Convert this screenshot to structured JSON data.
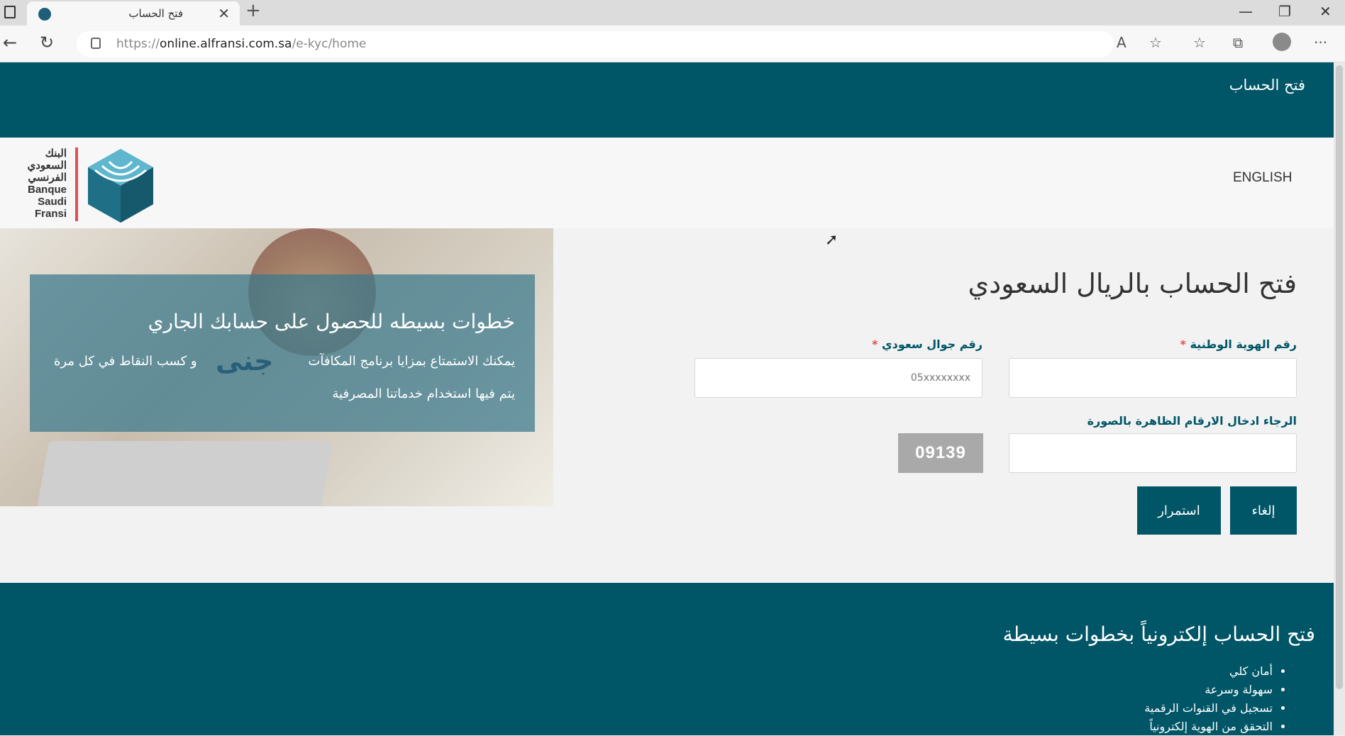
{
  "browser": {
    "tab_title": "فتح الحساب",
    "url_prefix": "https://",
    "url_host": "online.alfransi.com.sa",
    "url_path": "/e-kyc/home"
  },
  "top_band": {
    "title": "فتح الحساب"
  },
  "header": {
    "logo_lines": [
      "البنك",
      "السعودي",
      "الفرنسي",
      "Banque",
      "Saudi",
      "Fransi"
    ],
    "language_link": "ENGLISH"
  },
  "hero": {
    "title": "خطوات بسيطه للحصول على حسابك الجاري",
    "desc_line1": "يمكنك الاستمتاع بمزايا برنامج المكافآت",
    "desc_line1b": "و كسب النقاط في كل مرة",
    "desc_line2": "يتم فيها استخدام خدماتنا المصرفية",
    "rewards_brand": "جنى"
  },
  "form": {
    "title": "فتح الحساب بالريال السعودي",
    "national_id_label": "رقم الهوية الوطنية",
    "national_id_value": "",
    "mobile_label": "رقم جوال سعودي",
    "mobile_placeholder": "05xxxxxxxx",
    "captcha_label": "الرجاء ادخال الارقام الظاهرة بالصورة",
    "captcha_value": "",
    "captcha_code": "09139",
    "required_mark": "*",
    "cancel_label": "إلغاء",
    "continue_label": "استمرار"
  },
  "footer": {
    "title": "فتح الحساب إلكترونياً بخطوات بسيطة",
    "items": [
      "أمان كلي",
      "سهولة وسرعة",
      "تسجيل في القنوات الرقمية",
      "التحقق من الهوية إلكترونياً"
    ]
  },
  "colors": {
    "brand": "#005667",
    "required": "#e05050",
    "captcha_bg": "#a9a9a9"
  }
}
